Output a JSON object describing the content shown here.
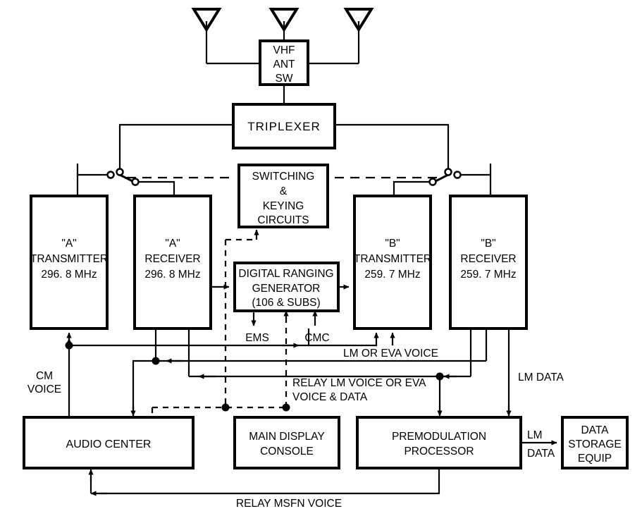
{
  "diagram": {
    "title": "VHF Communications Block Diagram",
    "antennas": [
      {
        "name": "vhf-antenna-left"
      },
      {
        "name": "vhf-antenna-center"
      },
      {
        "name": "vhf-antenna-right"
      }
    ],
    "boxes": {
      "vhf_ant_sw": {
        "lines": [
          "VHF",
          "ANT",
          "SW"
        ]
      },
      "triplexer": {
        "lines": [
          "TRIPLEXER"
        ]
      },
      "switching_keying": {
        "lines": [
          "SWITCHING",
          "&",
          "KEYING",
          "CIRCUITS"
        ]
      },
      "a_transmitter": {
        "lines": [
          "\"A\"",
          "TRANSMITTER",
          "296. 8 MHz"
        ]
      },
      "a_receiver": {
        "lines": [
          "\"A\"",
          "RECEIVER",
          "296. 8 MHz"
        ]
      },
      "b_transmitter": {
        "lines": [
          "\"B\"",
          "TRANSMITTER",
          "259. 7 MHz"
        ]
      },
      "b_receiver": {
        "lines": [
          "\"B\"",
          "RECEIVER",
          "259. 7 MHz"
        ]
      },
      "digital_ranging_generator": {
        "lines": [
          "DIGITAL RANGING",
          "GENERATOR",
          "(106 & SUBS)"
        ]
      },
      "audio_center": {
        "lines": [
          "AUDIO CENTER"
        ]
      },
      "main_display_console": {
        "lines": [
          "MAIN DISPLAY",
          "CONSOLE"
        ]
      },
      "premodulation_processor": {
        "lines": [
          "PREMODULATION",
          "PROCESSOR"
        ]
      },
      "data_storage_equip": {
        "lines": [
          "DATA",
          "STORAGE",
          "EQUIP"
        ]
      }
    },
    "signal_labels": {
      "ems": "EMS",
      "cmc": "CMC",
      "cm_voice": [
        "CM",
        "VOICE"
      ],
      "lm_or_eva_voice": "LM OR EVA VOICE",
      "relay_lm_voice": [
        "RELAY LM VOICE OR EVA",
        "VOICE & DATA"
      ],
      "lm_data_right": "LM DATA",
      "lm_data_storage": [
        "LM",
        "DATA"
      ],
      "relay_msfn_voice": "RELAY MSFN VOICE"
    },
    "colors": {
      "ink": "#000000",
      "background": "#ffffff"
    }
  }
}
